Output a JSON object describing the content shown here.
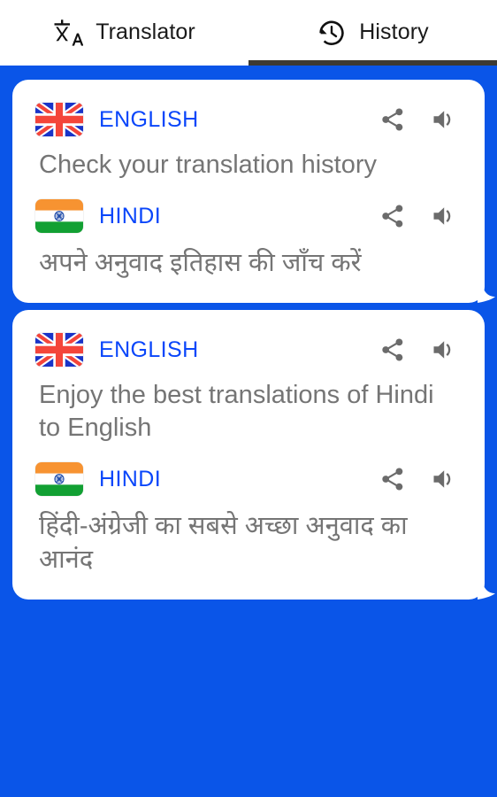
{
  "app": {
    "accent_blue": "#0a55e8",
    "link_blue": "#0a46fa",
    "body_gray": "#757575",
    "card_bg": "#ffffff",
    "tab_underline": "#3d3a33"
  },
  "tabs": [
    {
      "id": "translator",
      "label": "Translator",
      "icon": "translate-icon",
      "active": false
    },
    {
      "id": "history",
      "label": "History",
      "icon": "history-clock-icon",
      "active": true
    }
  ],
  "history": {
    "items": [
      {
        "source": {
          "flag": "flag-uk-icon",
          "language": "ENGLISH",
          "text": "Check your translation history",
          "share_icon": "share-icon",
          "speak_icon": "volume-speaker-icon"
        },
        "target": {
          "flag": "flag-india-icon",
          "language": "HINDI",
          "text": "अपने अनुवाद इतिहास की जाँच करें",
          "share_icon": "share-icon",
          "speak_icon": "volume-speaker-icon"
        }
      },
      {
        "source": {
          "flag": "flag-uk-icon",
          "language": "ENGLISH",
          "text": "Enjoy the best translations of Hindi to English",
          "share_icon": "share-icon",
          "speak_icon": "volume-speaker-icon"
        },
        "target": {
          "flag": "flag-india-icon",
          "language": "HINDI",
          "text": "हिंदी-अंग्रेजी का सबसे अच्छा अनुवाद का आनंद",
          "share_icon": "share-icon",
          "speak_icon": "volume-speaker-icon"
        }
      }
    ]
  }
}
